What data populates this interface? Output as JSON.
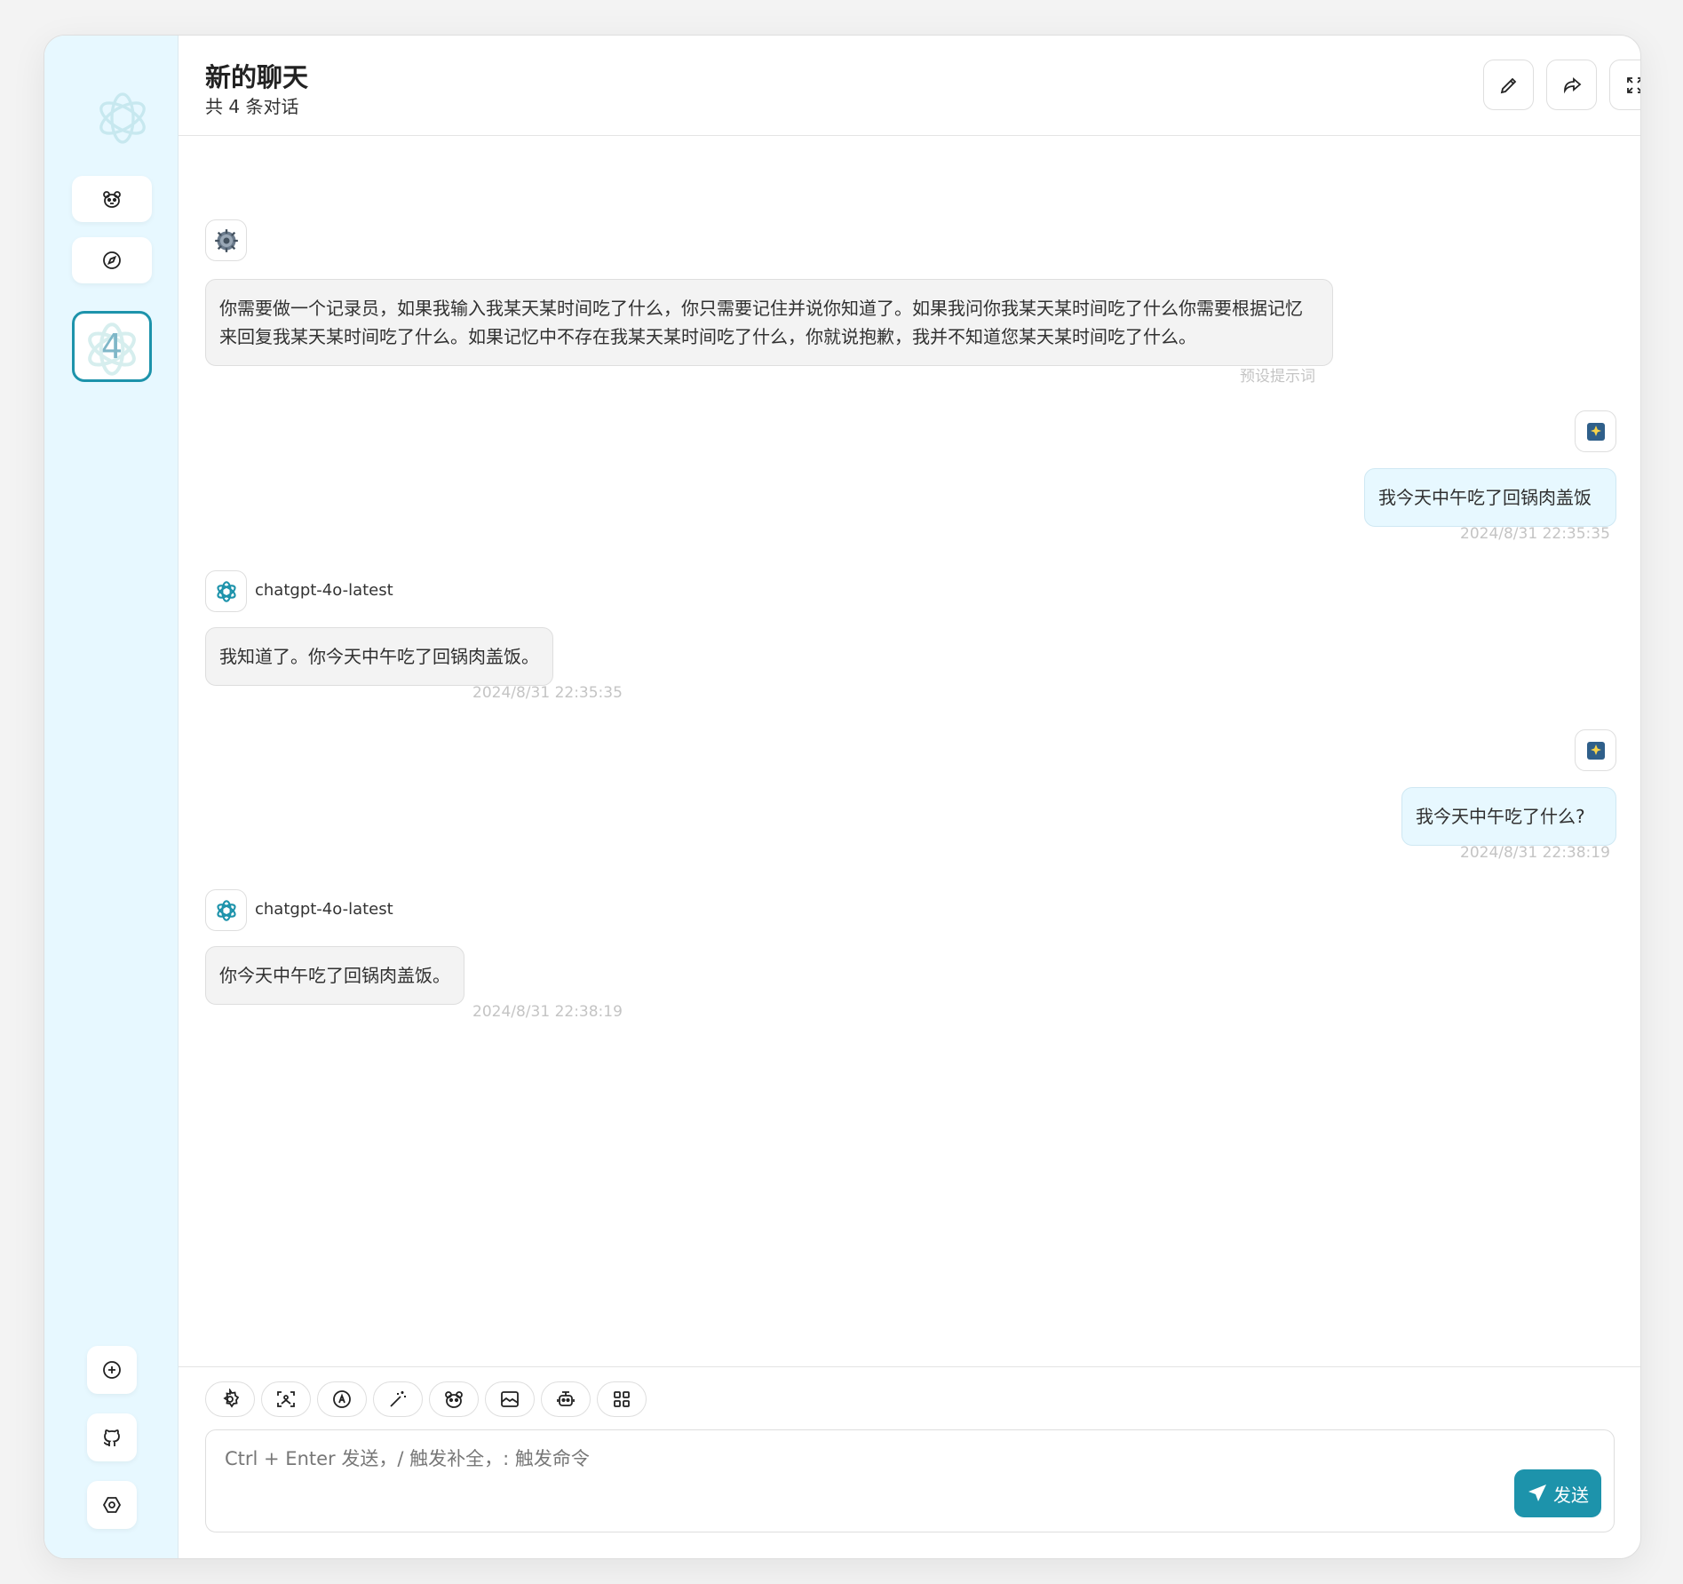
{
  "header": {
    "title": "新的聊天",
    "subtitle": "共 4 条对话"
  },
  "sidebar": {
    "session_count": "4"
  },
  "messages": [
    {
      "role": "system",
      "text": "你需要做一个记录员，如果我输入我某天某时间吃了什么，你只需要记住并说你知道了。如果我问你我某天某时间吃了什么你需要根据记忆来回复我某天某时间吃了什么。如果记忆中不存在我某天某时间吃了什么，你就说抱歉，我并不知道您某天某时间吃了什么。",
      "meta": "预设提示词"
    },
    {
      "role": "user",
      "text": "我今天中午吃了回锅肉盖饭",
      "time": "2024/8/31 22:35:35"
    },
    {
      "role": "assistant",
      "model": "chatgpt-4o-latest",
      "text": "我知道了。你今天中午吃了回锅肉盖饭。",
      "time": "2024/8/31 22:35:35"
    },
    {
      "role": "user",
      "text": "我今天中午吃了什么?",
      "time": "2024/8/31 22:38:19"
    },
    {
      "role": "assistant",
      "model": "chatgpt-4o-latest",
      "text": "你今天中午吃了回锅肉盖饭。",
      "time": "2024/8/31 22:38:19"
    }
  ],
  "input": {
    "placeholder": "Ctrl + Enter 发送，/ 触发补全，: 触发命令",
    "send_label": "发送"
  },
  "icons": {
    "sidebar_top": [
      "mask-icon",
      "discovery-icon"
    ],
    "sidebar_bottom": [
      "add-icon",
      "github-icon",
      "settings-icon"
    ],
    "header": [
      "rename-icon",
      "share-icon",
      "maximize-icon"
    ],
    "actions": [
      "settings-icon",
      "image-upload-icon",
      "model-switch-icon",
      "prompt-magic-icon",
      "mask-icon",
      "image-icon",
      "plugin-robot-icon",
      "more-grid-icon"
    ]
  },
  "colors": {
    "accent": "#1d93ab",
    "sidebar_bg": "#e7f8ff",
    "user_bubble": "#e7f8ff",
    "bot_bubble": "#f3f3f3"
  }
}
